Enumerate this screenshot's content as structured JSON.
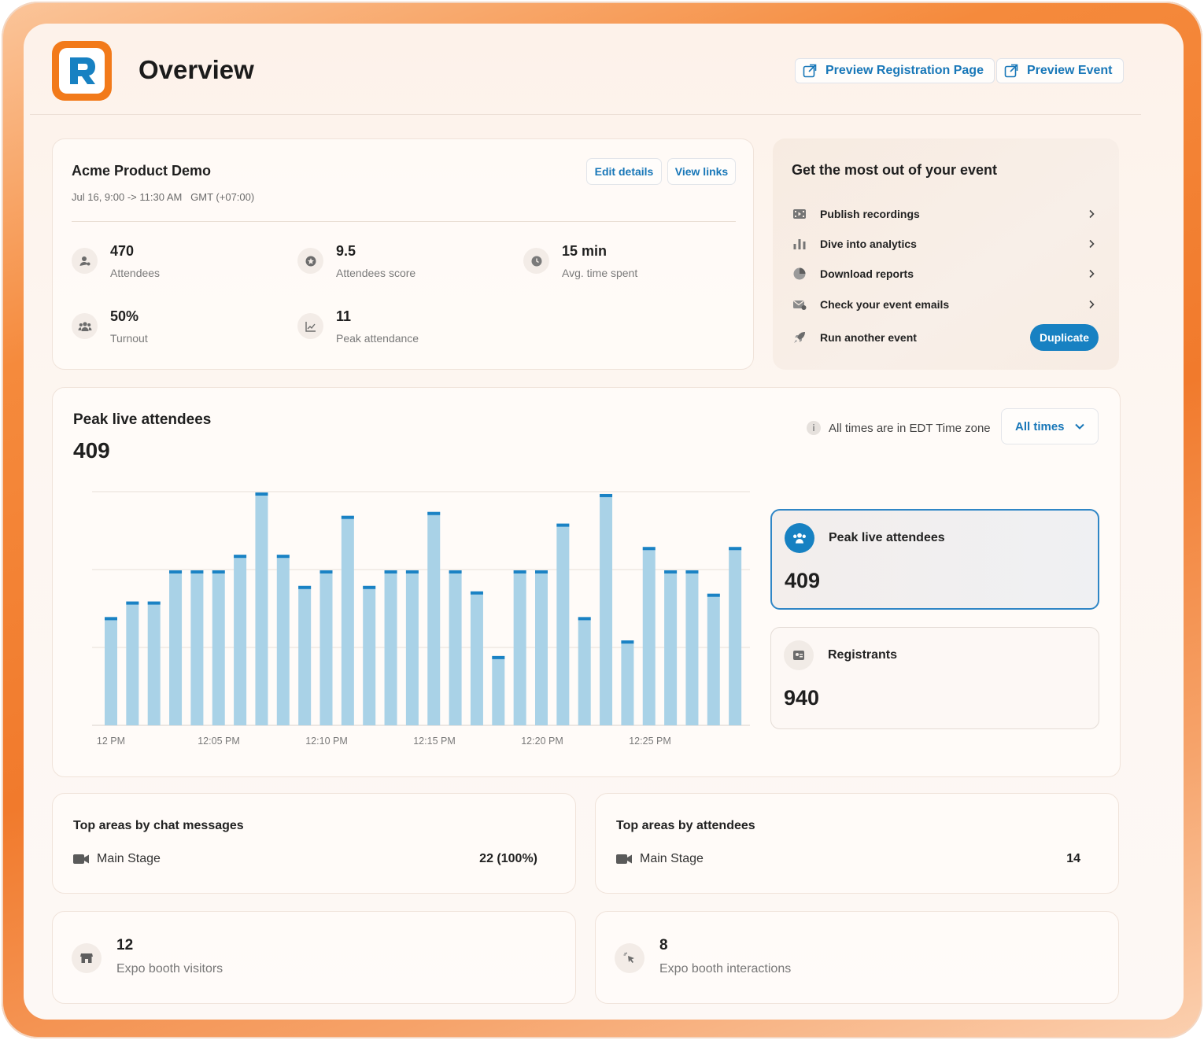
{
  "header": {
    "title": "Overview",
    "preview_registration": "Preview Registration Page",
    "preview_event": "Preview Event"
  },
  "event": {
    "name": "Acme Product Demo",
    "date": "Jul 16, 9:00 -> 11:30 AM   GMT (+07:00)",
    "edit_details": "Edit details",
    "view_links": "View links",
    "stats": [
      {
        "value": "470",
        "label": "Attendees",
        "icon": "user-icon"
      },
      {
        "value": "9.5",
        "label": "Attendees score",
        "icon": "star-icon"
      },
      {
        "value": "15 min",
        "label": "Avg. time spent",
        "icon": "clock-icon"
      },
      {
        "value": "50%",
        "label": "Turnout",
        "icon": "group-icon"
      },
      {
        "value": "11",
        "label": "Peak attendance",
        "icon": "trend-icon"
      }
    ]
  },
  "tips": {
    "title": "Get the most out of your event",
    "items": [
      {
        "label": "Publish recordings",
        "icon": "film-icon"
      },
      {
        "label": "Dive into analytics",
        "icon": "bar-chart-icon"
      },
      {
        "label": "Download reports",
        "icon": "pie-chart-icon"
      },
      {
        "label": "Check your event emails",
        "icon": "mail-icon"
      },
      {
        "label": "Run another event",
        "icon": "rocket-icon"
      }
    ],
    "duplicate": "Duplicate"
  },
  "peak": {
    "title": "Peak live attendees",
    "value": "409",
    "timezone_note": "All times are in EDT Time zone",
    "info_glyph": "i",
    "select_value": "All times"
  },
  "chart_data": {
    "type": "bar",
    "xlabel": "",
    "ylabel": "",
    "ylim": [
      0,
      300
    ],
    "tick_labels": [
      "12 PM",
      "12:05 PM",
      "12:10 PM",
      "12:15 PM",
      "12:20 PM",
      "12:25 PM"
    ],
    "values": [
      139,
      159,
      159,
      199,
      199,
      199,
      219,
      299,
      219,
      179,
      199,
      269,
      179,
      199,
      199,
      274,
      199,
      172,
      89,
      199,
      199,
      259,
      139,
      297,
      109,
      229,
      199,
      199,
      169,
      229
    ],
    "bar_color": "#a9d2e7",
    "cap_color": "#1a82c4",
    "grid": true
  },
  "kpis": {
    "peak_label": "Peak live attendees",
    "peak_value": "409",
    "registrants_label": "Registrants",
    "registrants_value": "940"
  },
  "areas": {
    "chat_title": "Top areas by chat messages",
    "chat_name": "Main Stage",
    "chat_value": "22 (100%)",
    "att_title": "Top areas by attendees",
    "att_name": "Main Stage",
    "att_value": "14"
  },
  "booth": {
    "visitors_value": "12",
    "visitors_label": "Expo booth visitors",
    "interactions_value": "8",
    "interactions_label": "Expo booth interactions"
  }
}
